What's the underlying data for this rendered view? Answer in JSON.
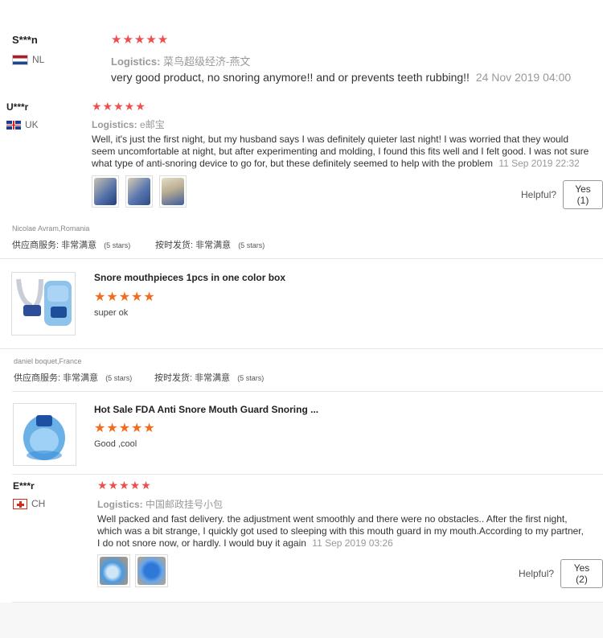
{
  "review1": {
    "name": "S***n",
    "country": "NL",
    "stars": "★★★★★",
    "logistics_label": "Logistics:",
    "logistics_value": "菜鸟超级经济-燕文",
    "text": "very good product, no snoring anymore!! and or prevents teeth rubbing!!",
    "date": "24 Nov 2019 04:00"
  },
  "review2": {
    "name": "U***r",
    "country": "UK",
    "stars": "★★★★★",
    "logistics_label": "Logistics:",
    "logistics_value": "e邮宝",
    "text": "Well, it's just the first night, but my husband says I was definitely quieter last night! I was worried that they would seem uncomfortable at night, but after experimenting and molding, I found this fits well and I felt good. I was not sure what type of anti-snoring device to go for, but these definitely seemed to help with the problem",
    "date": "11 Sep 2019 22:32",
    "helpful_label": "Helpful?",
    "yes_label": "Yes (1)"
  },
  "block1": {
    "author": "Nicolae Avram,Romania",
    "service_label": "供应商服务:",
    "service_value": "非常满意",
    "service_stars": "(5 stars)",
    "shipping_label": "按时发货:",
    "shipping_value": "非常满意",
    "shipping_stars": "(5 stars)",
    "product_title": "Snore mouthpieces 1pcs in one color box",
    "stars": "★★★★★",
    "comment": "super ok"
  },
  "block2": {
    "author": "daniel boquet,France",
    "service_label": "供应商服务:",
    "service_value": "非常满意",
    "service_stars": "(5 stars)",
    "shipping_label": "按时发货:",
    "shipping_value": "非常满意",
    "shipping_stars": "(5 stars)",
    "product_title": "Hot Sale FDA Anti Snore Mouth Guard Snoring ...",
    "stars": "★★★★★",
    "comment": "Good ,cool"
  },
  "review3": {
    "name": "E***r",
    "country": "CH",
    "stars": "★★★★★",
    "logistics_label": "Logistics:",
    "logistics_value": "中国邮政挂号小包",
    "text": "Well packed and fast delivery. the adjustment went smoothly and there were no obstacles.. After the first night, which was a bit strange, I quickly got used to sleeping with this mouth guard in my mouth.According to my partner, I do not snore now, or hardly. I would buy it again",
    "date": "11 Sep 2019 03:26",
    "helpful_label": "Helpful?",
    "yes_label": "Yes (2)"
  },
  "colors": {
    "star_red": "#f04d4d",
    "star_orange": "#f26c1c",
    "muted": "#999999"
  }
}
